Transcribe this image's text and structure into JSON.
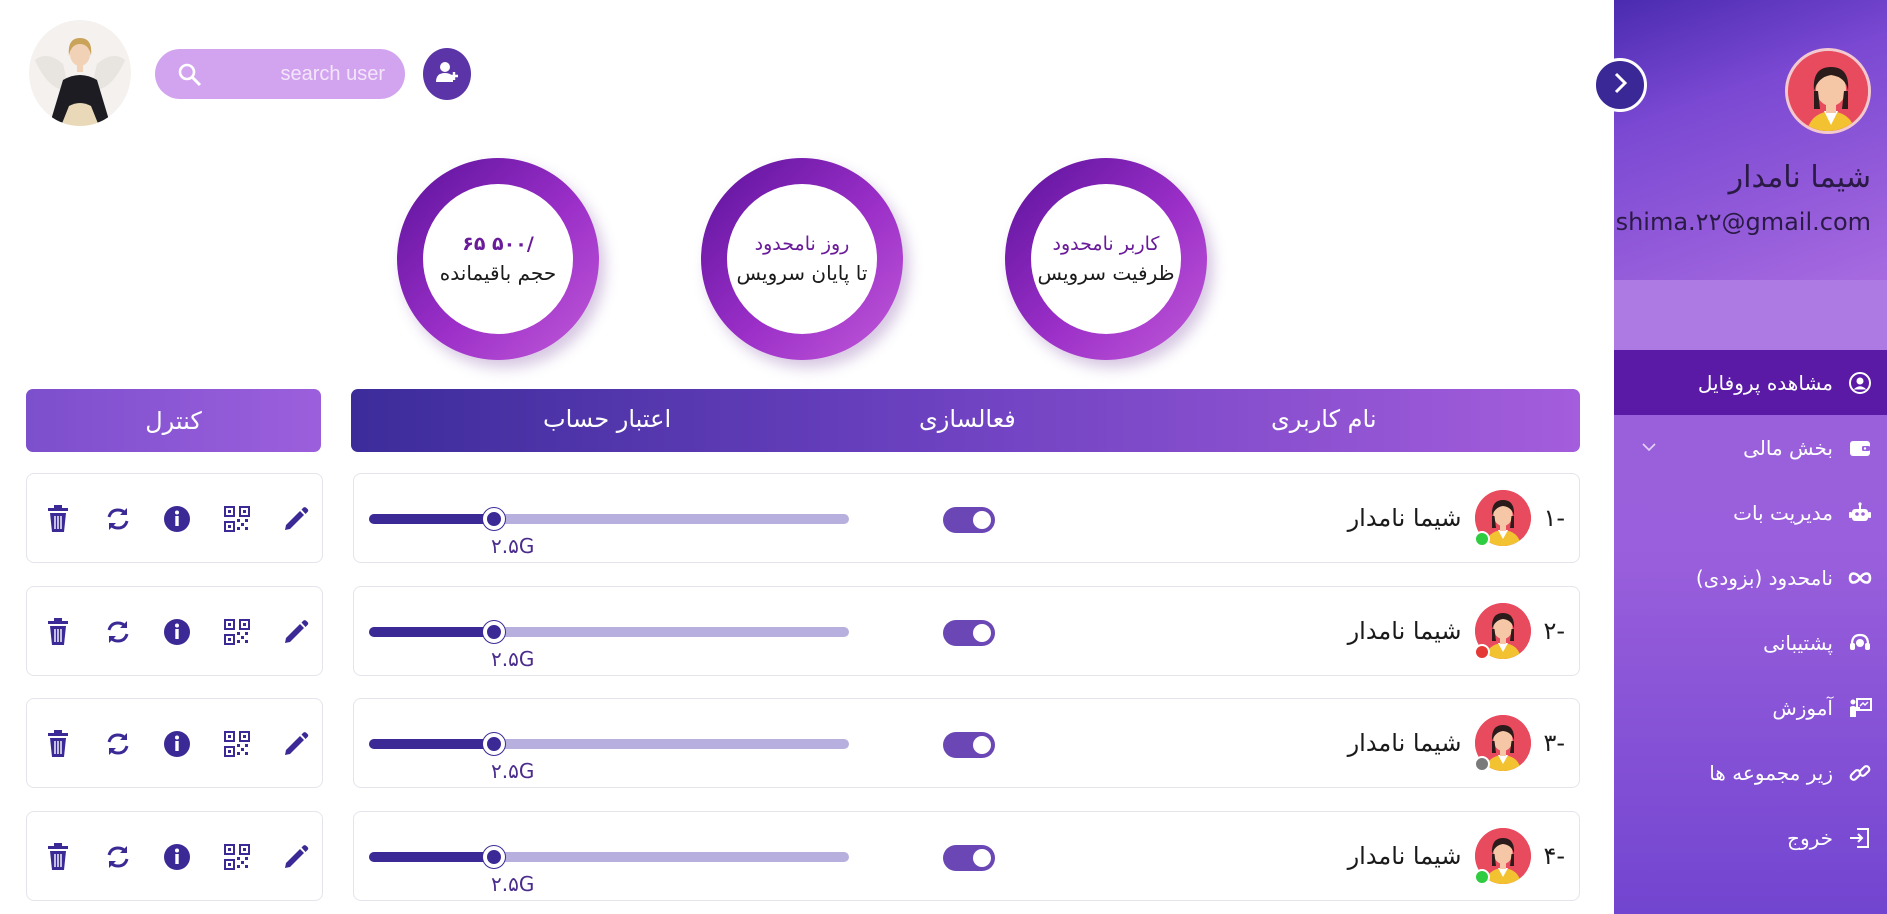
{
  "sidebar": {
    "user_name": "شیما نامدار",
    "user_email": "shima.۲۲@gmail.com",
    "items": [
      {
        "label": "مشاهده پروفایل",
        "icon": "user-circle-icon",
        "active": true
      },
      {
        "label": "بخش مالی",
        "icon": "wallet-icon",
        "expandable": true
      },
      {
        "label": "مدیریت بات",
        "icon": "robot-icon"
      },
      {
        "label": "نامحدود (بزودی)",
        "icon": "infinity-icon"
      },
      {
        "label": "پشتیبانی",
        "icon": "headset-icon"
      },
      {
        "label": "آموزش",
        "icon": "teaching-icon"
      },
      {
        "label": "زیر مجموعه ها",
        "icon": "link-icon"
      },
      {
        "label": "خروج",
        "icon": "logout-icon"
      }
    ]
  },
  "topbar": {
    "search_placeholder": "search user"
  },
  "stats": [
    {
      "line1": "/۵۰۰     ۶۵",
      "line2": "حجم باقیمانده"
    },
    {
      "line1": "روز نامحدود",
      "line2": "تا پایان سرویس"
    },
    {
      "line1": "کاربر نامحدود",
      "line2": "ظرفیت سرویس"
    }
  ],
  "table": {
    "control_header": "کنترل",
    "col_username": "نام کاربری",
    "col_activation": "فعالسازی",
    "col_credit": "اعتبار حساب",
    "rows": [
      {
        "index": "-۱",
        "name": "شیما نامدار",
        "volume": "۲.۵G",
        "usage": 0.26,
        "active": true,
        "status_color": "#2ecc40"
      },
      {
        "index": "-۲",
        "name": "شیما نامدار",
        "volume": "۲.۵G",
        "usage": 0.26,
        "active": true,
        "status_color": "#e53935"
      },
      {
        "index": "-۳",
        "name": "شیما نامدار",
        "volume": "۲.۵G",
        "usage": 0.26,
        "active": true,
        "status_color": "#7a7a7a"
      },
      {
        "index": "-۴",
        "name": "شیما نامدار",
        "volume": "۲.۵G",
        "usage": 0.26,
        "active": true,
        "status_color": "#2ecc40"
      }
    ],
    "control_icons": [
      "delete-icon",
      "refresh-icon",
      "info-icon",
      "qr-code-icon",
      "edit-icon"
    ]
  },
  "colors": {
    "primary": "#3b2a96",
    "accent": "#9b5fdc",
    "active_item": "#5a1aa6"
  }
}
